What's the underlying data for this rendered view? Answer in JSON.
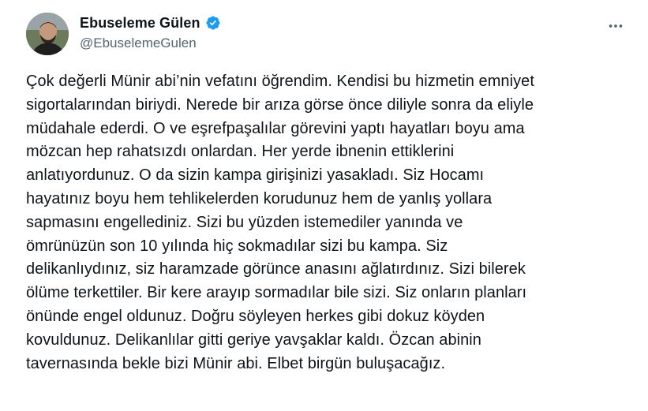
{
  "author": {
    "display_name": "Ebuseleme Gülen",
    "handle": "@EbuselemeGulen"
  },
  "icons": {
    "verified": "verified-badge-icon",
    "more": "more-options-icon",
    "verified_color": "#1d9bf0"
  },
  "tweet": {
    "text": "Çok değerli Münir abi’nin vefatını öğrendim. Kendisi bu hizmetin emniyet\nsigortalarından biriydi. Nerede bir arıza görse önce diliyle sonra da eliyle\nmüdahale ederdi. O ve eşrefpaşalılar görevini yaptı hayatları boyu ama\nmözcan hep rahatsızdı onlardan. Her yerde ibnenin ettiklerini\nanlatıyordunuz. O da sizin kampa girişinizi yasakladı. Siz Hocamı\nhayatınız boyu hem tehlikelerden korudunuz hem de yanlış yollara\nsapmasını engellediniz. Sizi bu yüzden istemediler yanında ve\nömrünüzün son 10 yılında hiç sokmadılar sizi bu kampa. Siz\ndelikanlıydınız, siz haramzade görünce anasını ağlatırdınız. Sizi bilerek\nölüme terkettiler. Bir kere arayıp sormadılar bile sizi. Siz onların planları\nönünde engel oldunuz. Doğru söyleyen herkes gibi dokuz köyden\nkovuldunuz. Delikanlılar gitti geriye yavşaklar kaldı. Özcan abinin\ntavernasında bekle bizi Münir abi. Elbet birgün buluşacağız."
  }
}
